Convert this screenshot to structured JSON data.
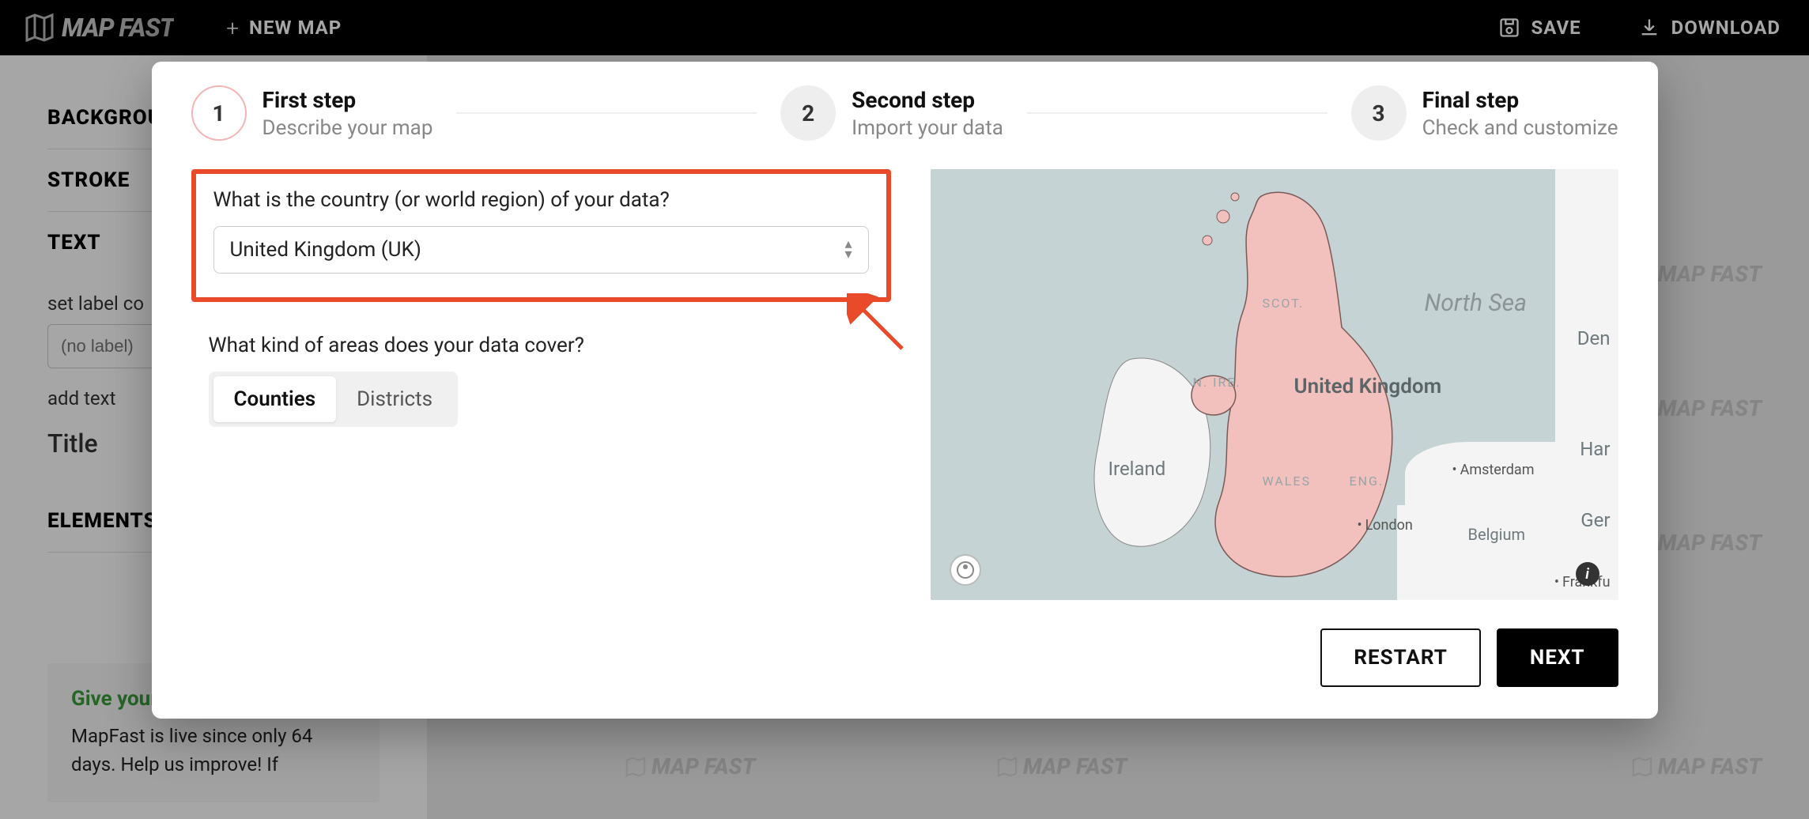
{
  "app": {
    "logo_text": "MAP FAST",
    "new_map_label": "NEW MAP",
    "save_label": "SAVE",
    "download_label": "DOWNLOAD"
  },
  "sidebar": {
    "sections": {
      "background": "BACKGROUND",
      "stroke": "STROKE",
      "text": "TEXT",
      "elements": "ELEMENTS"
    },
    "set_label_col": "set label co",
    "no_label_placeholder": "(no label)",
    "add_text": "add text",
    "title": "Title"
  },
  "feedback": {
    "title": "Give your f",
    "body": "MapFast is live since only 64 days. Help us improve! If"
  },
  "wizard": {
    "steps": [
      {
        "num": "1",
        "title": "First step",
        "sub": "Describe your map"
      },
      {
        "num": "2",
        "title": "Second step",
        "sub": "Import your data"
      },
      {
        "num": "3",
        "title": "Final step",
        "sub": "Check and customize"
      }
    ],
    "country_question": "What is the country (or world region) of your data?",
    "country_value": "United Kingdom (UK)",
    "area_question": "What kind of areas does your data cover?",
    "area_options": {
      "counties": "Counties",
      "districts": "Districts"
    },
    "restart_label": "RESTART",
    "next_label": "NEXT"
  },
  "map": {
    "north_sea": "North Sea",
    "uk": "United Kingdom",
    "ireland": "Ireland",
    "n_ire": "N. IRE.",
    "scot": "SCOT.",
    "wales": "WALES",
    "eng": "ENG.",
    "den": "Den",
    "ger": "Ger",
    "belgium": "Belgium",
    "har": "Har",
    "amsterdam": "Amsterdam",
    "london": "London",
    "frankfu": "Frankfu"
  },
  "watermark_text": "MAP FAST"
}
